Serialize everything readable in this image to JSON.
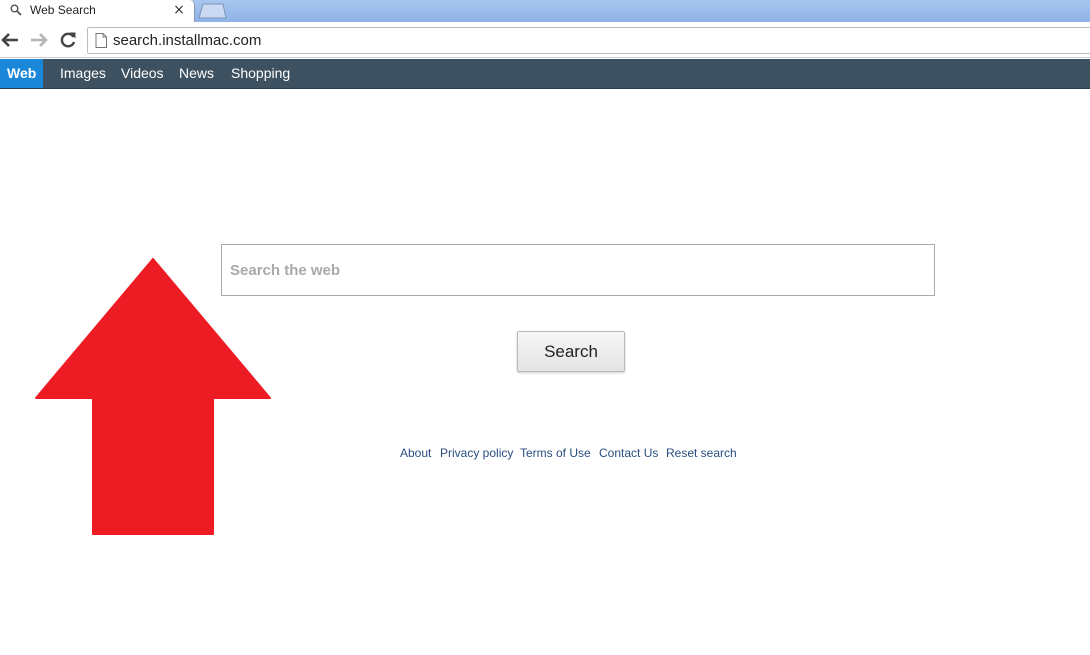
{
  "browser": {
    "tab_title": "Web Search",
    "tab_close": "×",
    "url": "search.installmac.com"
  },
  "navbar": {
    "items": [
      {
        "label": "Web",
        "active": true
      },
      {
        "label": "Images",
        "active": false
      },
      {
        "label": "Videos",
        "active": false
      },
      {
        "label": "News",
        "active": false
      },
      {
        "label": "Shopping",
        "active": false
      }
    ]
  },
  "search": {
    "placeholder": "Search the web",
    "button_label": "Search"
  },
  "footer": {
    "links": [
      "About",
      "Privacy policy",
      "Terms of Use",
      "Contact Us",
      "Reset search"
    ]
  },
  "colors": {
    "navbar_bg": "#3d5161",
    "active_tab_bg": "#1b87d9",
    "arrow": "#ed1c24",
    "link": "#2a4d80"
  },
  "icons": {
    "tab": "search-icon",
    "back": "back-arrow-icon",
    "forward": "forward-arrow-icon",
    "reload": "reload-icon",
    "page": "page-icon",
    "annotation": "red-up-arrow-icon"
  }
}
